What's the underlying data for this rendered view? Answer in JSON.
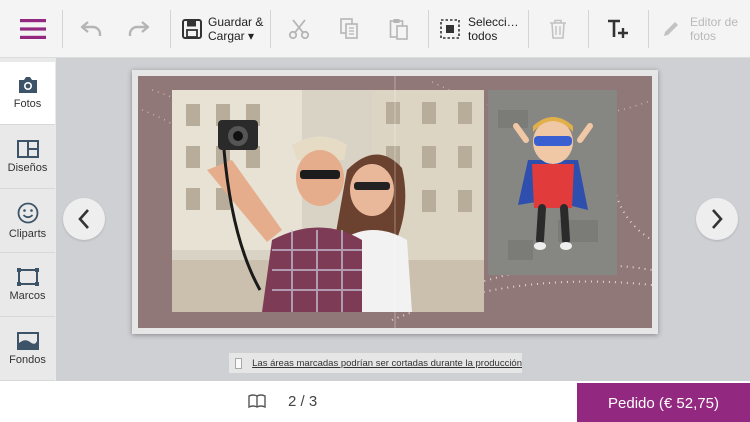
{
  "toolbar": {
    "save_line1": "Guardar &",
    "save_line2": "Cargar ▾",
    "select_line1": "Selecci…",
    "select_line2": "todos",
    "editor_line1": "Editor de",
    "editor_line2": "fotos"
  },
  "sidebar": {
    "items": [
      {
        "label": "Fotos",
        "icon": "camera-icon"
      },
      {
        "label": "Diseños",
        "icon": "layout-icon"
      },
      {
        "label": "Cliparts",
        "icon": "smiley-icon"
      },
      {
        "label": "Marcos",
        "icon": "frame-icon"
      },
      {
        "label": "Fondos",
        "icon": "background-image-icon"
      }
    ]
  },
  "canvas": {
    "notice_text": "Las áreas marcadas podrían ser cortadas durante la producción"
  },
  "footer": {
    "page_indicator": "2 / 3",
    "order_label": "Pedido (€ 52,75)"
  },
  "colors": {
    "accent": "#92287f",
    "album_background": "#8f7877"
  }
}
